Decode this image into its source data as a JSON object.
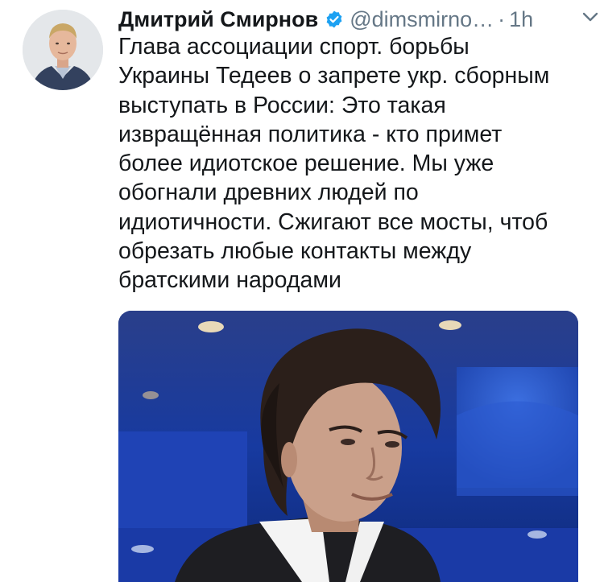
{
  "tweet": {
    "author_name": "Дмитрий Смирнов",
    "handle": "@dimsmirno…",
    "separator": "·",
    "time": "1h",
    "verified": true,
    "text": "Глава ассоциации спорт. борьбы\nУкраины Тедеев о запрете укр. сборным\nвыступать в России: Это такая\nизвращённая политика - кто примет\nболее идиотское решение. Мы уже\nобогнали древних людей по\nидиотичности. Сжигают все мосты, чтоб\nобрезать любые контакты между\nбратскими народами"
  },
  "icons": {
    "verified": "verified-badge-icon",
    "menu": "chevron-down-icon"
  },
  "colors": {
    "text": "#14171a",
    "secondary": "#657786",
    "verified_blue": "#1da1f2",
    "media_background": "#1d3b8f"
  }
}
